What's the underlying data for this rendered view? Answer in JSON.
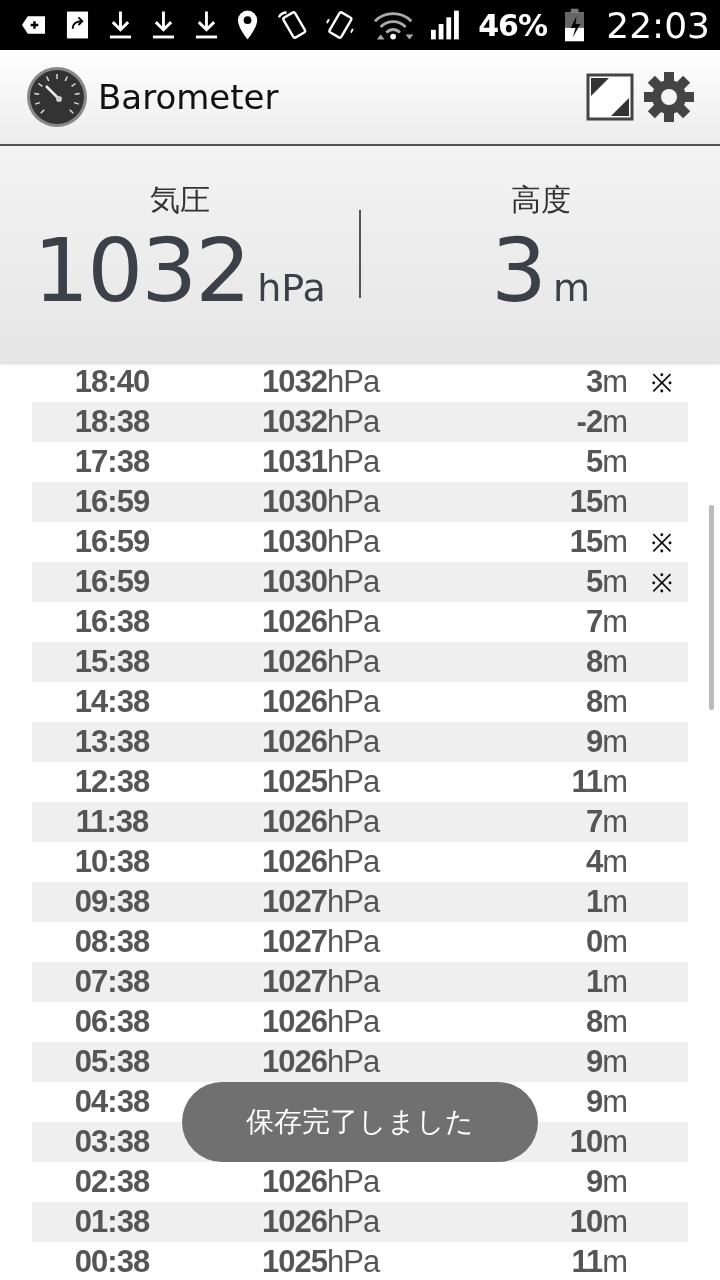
{
  "status_bar": {
    "battery": "46%",
    "time": "22:03"
  },
  "app_bar": {
    "title": "Barometer"
  },
  "readout": {
    "pressure": {
      "label": "気圧",
      "value": "1032",
      "unit": "hPa"
    },
    "altitude": {
      "label": "高度",
      "value": "3",
      "unit": "m"
    }
  },
  "history": [
    {
      "time": "18:40",
      "pressure": "**1032**hPa",
      "altitude": "**3**m",
      "note": "※"
    },
    {
      "time": "18:38",
      "pressure": "**1032**hPa",
      "altitude": "**-2**m"
    },
    {
      "time": "17:38",
      "pressure": "**1031**hPa",
      "altitude": "**5**m"
    },
    {
      "time": "16:59",
      "pressure": "**1030**hPa",
      "altitude": "**15**m"
    },
    {
      "time": "16:59",
      "pressure": "**1030**hPa",
      "altitude": "**15**m",
      "note": "※"
    },
    {
      "time": "16:59",
      "pressure": "**1030**hPa",
      "altitude": "**5**m",
      "note": "※"
    },
    {
      "time": "16:38",
      "pressure": "**1026**hPa",
      "altitude": "**7**m"
    },
    {
      "time": "15:38",
      "pressure": "**1026**hPa",
      "altitude": "**8**m"
    },
    {
      "time": "14:38",
      "pressure": "**1026**hPa",
      "altitude": "**8**m"
    },
    {
      "time": "13:38",
      "pressure": "**1026**hPa",
      "altitude": "**9**m"
    },
    {
      "time": "12:38",
      "pressure": "**1025**hPa",
      "altitude": "**11**m"
    },
    {
      "time": "11:38",
      "pressure": "**1026**hPa",
      "altitude": "**7**m"
    },
    {
      "time": "10:38",
      "pressure": "**1026**hPa",
      "altitude": "**4**m"
    },
    {
      "time": "09:38",
      "pressure": "**1027**hPa",
      "altitude": "**1**m"
    },
    {
      "time": "08:38",
      "pressure": "**1027**hPa",
      "altitude": "**0**m"
    },
    {
      "time": "07:38",
      "pressure": "**1027**hPa",
      "altitude": "**1**m"
    },
    {
      "time": "06:38",
      "pressure": "**1026**hPa",
      "altitude": "**8**m"
    },
    {
      "time": "05:38",
      "pressure": "**1026**hPa",
      "altitude": "**9**m"
    },
    {
      "time": "04:38",
      "altitude": "**9**m"
    },
    {
      "time": "03:38",
      "altitude": "**10**m"
    },
    {
      "time": "02:38",
      "pressure": "**1026**hPa",
      "altitude": "**9**m"
    },
    {
      "time": "01:38",
      "pressure": "**1026**hPa",
      "altitude": "**10**m"
    },
    {
      "time": "00:38",
      "pressure": "**1025**hPa",
      "altitude": "**11**m"
    }
  ],
  "toast": "保存完了しました"
}
